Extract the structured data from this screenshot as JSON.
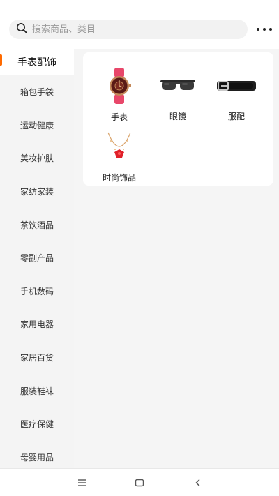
{
  "search": {
    "placeholder": "搜索商品、类目"
  },
  "header": {
    "more_icon": "more-dots-icon"
  },
  "sidebar": {
    "items": [
      {
        "label": "手表配饰",
        "active": true
      },
      {
        "label": "箱包手袋"
      },
      {
        "label": "运动健康"
      },
      {
        "label": "美妆护肤"
      },
      {
        "label": "家纺家装"
      },
      {
        "label": "茶饮酒品"
      },
      {
        "label": "零副产品"
      },
      {
        "label": "手机数码"
      },
      {
        "label": "家用电器"
      },
      {
        "label": "家居百货"
      },
      {
        "label": "服装鞋袜"
      },
      {
        "label": "医疗保健"
      },
      {
        "label": "母婴用品"
      }
    ]
  },
  "categories": [
    {
      "label": "手表",
      "icon": "watch-icon"
    },
    {
      "label": "眼镜",
      "icon": "glasses-icon"
    },
    {
      "label": "服配",
      "icon": "belt-icon"
    },
    {
      "label": "时尚饰品",
      "icon": "necklace-icon"
    }
  ],
  "colors": {
    "accent": "#ff6a00",
    "watch_strap": "#e8476a",
    "necklace": "#e0202a"
  },
  "navbar": {
    "menu_icon": "menu-icon",
    "home_icon": "home-square-icon",
    "back_icon": "back-chevron-icon"
  }
}
